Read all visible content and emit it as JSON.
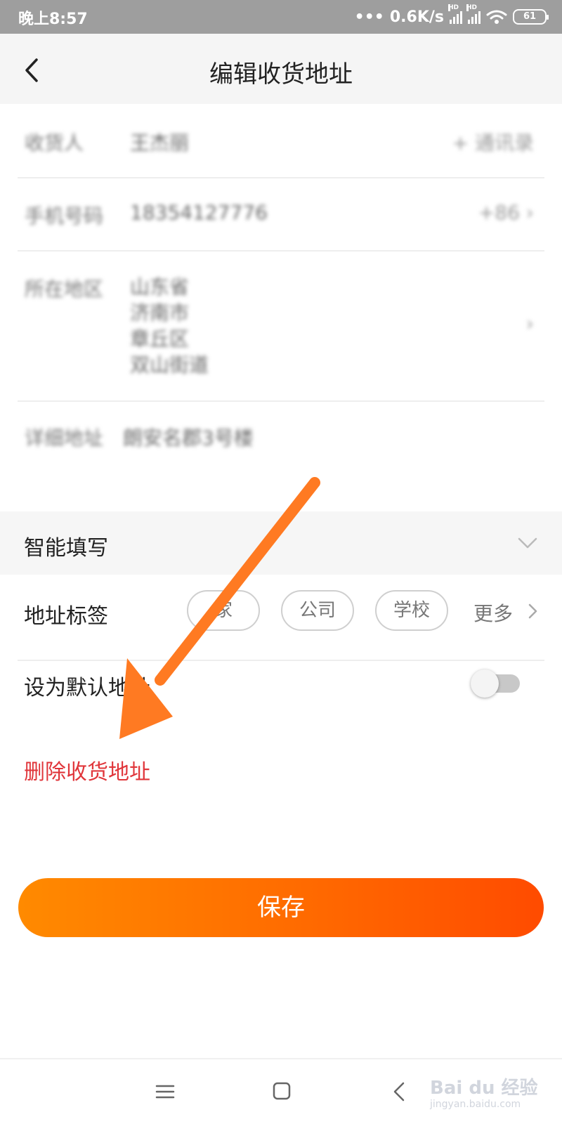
{
  "status_bar": {
    "time": "晚上8:57",
    "network_speed": "0.6K/s",
    "hd_label": "HD",
    "battery": "61"
  },
  "header": {
    "title": "编辑收货地址"
  },
  "form": {
    "name_label": "收货人",
    "name_value": "王杰丽",
    "contacts_link": "+ 通讯录",
    "phone_label": "手机号码",
    "phone_value": "18354127776",
    "phone_prefix": "+86",
    "region_label": "所在地区",
    "region_lines": [
      "山东省",
      "济南市",
      "章丘区",
      "双山街道"
    ],
    "detail_label": "详细地址",
    "detail_value": "朗安名郡3号楼"
  },
  "smart_fill": {
    "label": "智能填写"
  },
  "address_tags": {
    "label": "地址标签",
    "tags": [
      "家",
      "公司",
      "学校"
    ],
    "more": "更多"
  },
  "default_address": {
    "label": "设为默认地址",
    "enabled": false
  },
  "delete_label": "删除收货地址",
  "save_label": "保存",
  "watermark": {
    "logo": "Bai du 经验",
    "url": "jingyan.baidu.com"
  },
  "colors": {
    "accent_orange": "#ff6a00",
    "delete_red": "#e0353a",
    "annotation_arrow": "#ff7a22"
  }
}
